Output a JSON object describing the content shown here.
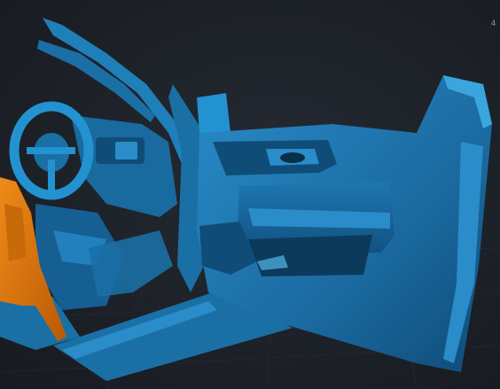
{
  "viewport": {
    "corner_label": "4",
    "background": "#1b1f26"
  },
  "scan": {
    "primary_color": "#1f7fb8",
    "highlight_color": "#3aa6dd",
    "shadow_color": "#0c3a5a",
    "secondary_color": "#e07a10"
  }
}
